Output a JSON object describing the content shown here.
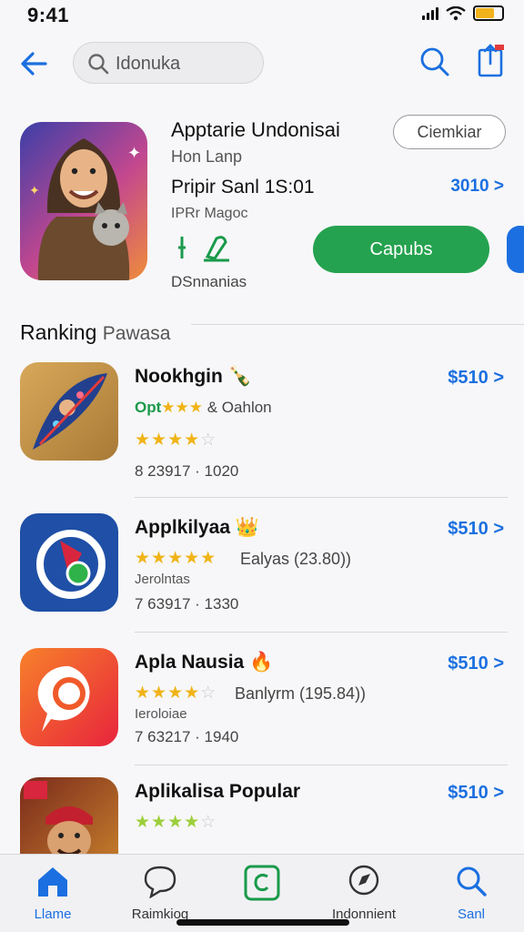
{
  "status": {
    "time": "9:41"
  },
  "search": {
    "query": "Idonuka"
  },
  "featured": {
    "title": "Apptarie Undonisai",
    "subtitle": "Hon Lanp",
    "line2": "Pripir Sanl 1S:01",
    "line3": "IPRr Magoc",
    "developer": "DSnnanias",
    "pill_label": "Ciemkiar",
    "price": "3010 >",
    "get_label": "Capubs"
  },
  "section": {
    "title": "Ranking",
    "subtitle": "Pawasa"
  },
  "apps": [
    {
      "name": "Nookhgin",
      "price": "$510 >",
      "label": "Opt",
      "label_rest": "& Oahlon",
      "stars": "★★★★",
      "stars_off": "☆",
      "meta": "8 23917 · 1020"
    },
    {
      "name": "Applkilyaa",
      "price": "$510 >",
      "stars": "★★★★★",
      "stars_off": "",
      "rating_text": "Ealyas (23.80))",
      "developer": "Jerolntas",
      "meta": "7 63917 · 1330"
    },
    {
      "name": "Apla Nausia",
      "price": "$510 >",
      "stars": "★★★★",
      "stars_off": "☆",
      "rating_text": "Banlyrm (195.84))",
      "developer": "Ieroloiae",
      "meta": "7 63217 · 1940"
    },
    {
      "name": "Aplikalisa Popular",
      "price": "$510 >",
      "stars": "★★★★",
      "stars_off": "☆"
    }
  ],
  "tabs": [
    {
      "label": "Llame"
    },
    {
      "label": "Raimkiog"
    },
    {
      "label": ""
    },
    {
      "label": "Indonnient"
    },
    {
      "label": "Sanl"
    }
  ],
  "colors": {
    "accent": "#1b6fe0",
    "green": "#25a24f",
    "star": "#f0b418"
  }
}
